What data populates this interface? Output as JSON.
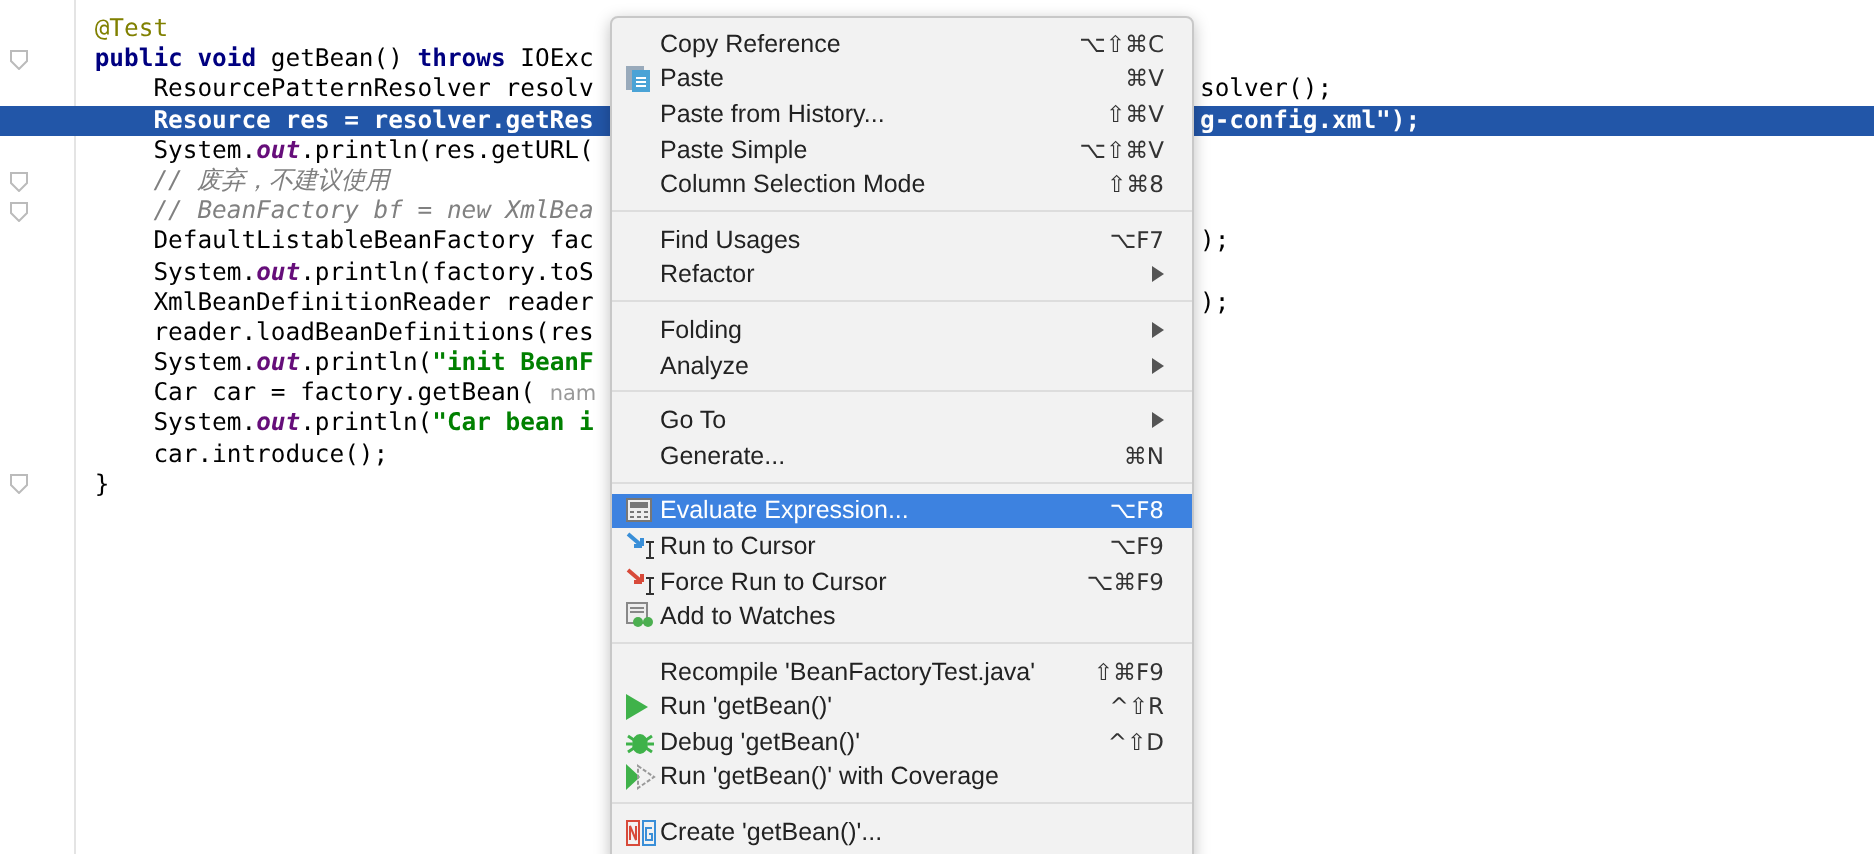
{
  "editor": {
    "lines": [
      {
        "folding": false,
        "selected": false,
        "segments": [
          {
            "kind": "annotation",
            "text": "    @Test"
          }
        ]
      },
      {
        "folding": true,
        "selected": false,
        "segments": [
          {
            "kind": "keyword",
            "text": "    public void"
          },
          {
            "kind": "plain",
            "text": " getBean() "
          },
          {
            "kind": "keyword",
            "text": "throws"
          },
          {
            "kind": "plain",
            "text": " IOExc"
          }
        ]
      },
      {
        "folding": false,
        "selected": false,
        "segments": [
          {
            "kind": "plain",
            "text": "        ResourcePatternResolver resolv"
          }
        ],
        "right": "solver();"
      },
      {
        "folding": false,
        "selected": true,
        "segments": [
          {
            "kind": "plain",
            "text": "        Resource res = resolver.getRes"
          }
        ],
        "right": "g-config.xml\");"
      },
      {
        "folding": false,
        "selected": false,
        "segments": [
          {
            "kind": "plain",
            "text": "        System."
          },
          {
            "kind": "field",
            "text": "out"
          },
          {
            "kind": "plain",
            "text": ".println(res.getURL("
          }
        ]
      },
      {
        "folding": true,
        "selected": false,
        "segments": [
          {
            "kind": "comment",
            "text": "        // 废弃，不建议使用"
          }
        ]
      },
      {
        "folding": true,
        "selected": false,
        "segments": [
          {
            "kind": "comment",
            "text": "        // BeanFactory bf = new XmlBea"
          }
        ]
      },
      {
        "folding": false,
        "selected": false,
        "segments": [
          {
            "kind": "plain",
            "text": "        DefaultListableBeanFactory fac"
          }
        ],
        "right": ");"
      },
      {
        "folding": false,
        "selected": false,
        "segments": [
          {
            "kind": "plain",
            "text": "        System."
          },
          {
            "kind": "field",
            "text": "out"
          },
          {
            "kind": "plain",
            "text": ".println(factory.toS"
          }
        ]
      },
      {
        "folding": false,
        "selected": false,
        "segments": [
          {
            "kind": "plain",
            "text": "        XmlBeanDefinitionReader reader"
          }
        ],
        "right": ");"
      },
      {
        "folding": false,
        "selected": false,
        "segments": [
          {
            "kind": "plain",
            "text": "        reader.loadBeanDefinitions(res"
          }
        ]
      },
      {
        "folding": false,
        "selected": false,
        "segments": [
          {
            "kind": "plain",
            "text": "        System."
          },
          {
            "kind": "field",
            "text": "out"
          },
          {
            "kind": "plain",
            "text": ".println("
          },
          {
            "kind": "string",
            "text": "\"init BeanF"
          }
        ]
      },
      {
        "folding": false,
        "selected": false,
        "segments": [
          {
            "kind": "plain",
            "text": "        Car car = factory.getBean( "
          },
          {
            "kind": "hint",
            "text": "nam"
          }
        ]
      },
      {
        "folding": false,
        "selected": false,
        "segments": [
          {
            "kind": "plain",
            "text": "        System."
          },
          {
            "kind": "field",
            "text": "out"
          },
          {
            "kind": "plain",
            "text": ".println("
          },
          {
            "kind": "string",
            "text": "\"Car bean i"
          }
        ]
      },
      {
        "folding": false,
        "selected": false,
        "segments": [
          {
            "kind": "plain",
            "text": "        car.introduce();"
          }
        ]
      },
      {
        "folding": true,
        "selected": false,
        "segments": [
          {
            "kind": "plain",
            "text": "    }"
          }
        ]
      }
    ]
  },
  "context_menu": {
    "groups": [
      [
        {
          "label": "Copy Reference",
          "shortcut": "⌥⇧⌘C",
          "submenu": false,
          "selected": false
        },
        {
          "label": "Paste",
          "shortcut": "⌘V",
          "kind": "paste",
          "submenu": false,
          "selected": false
        },
        {
          "label": "Paste from History...",
          "shortcut": "⇧⌘V",
          "submenu": false,
          "selected": false
        },
        {
          "label": "Paste Simple",
          "shortcut": "⌥⇧⌘V",
          "submenu": false,
          "selected": false
        },
        {
          "label": "Column Selection Mode",
          "shortcut": "⇧⌘8",
          "submenu": false,
          "selected": false
        }
      ],
      [
        {
          "label": "Find Usages",
          "shortcut": "⌥F7",
          "submenu": false,
          "selected": false
        },
        {
          "label": "Refactor",
          "submenu": true,
          "selected": false
        }
      ],
      [
        {
          "label": "Folding",
          "submenu": true,
          "selected": false
        },
        {
          "label": "Analyze",
          "submenu": true,
          "selected": false
        }
      ],
      [
        {
          "label": "Go To",
          "submenu": true,
          "selected": false
        },
        {
          "label": "Generate...",
          "shortcut": "⌘N",
          "submenu": false,
          "selected": false
        }
      ],
      [
        {
          "label": "Evaluate Expression...",
          "shortcut": "⌥F8",
          "kind": "evaluate",
          "submenu": false,
          "selected": true
        },
        {
          "label": "Run to Cursor",
          "shortcut": "⌥F9",
          "kind": "run-to-cursor",
          "submenu": false,
          "selected": false
        },
        {
          "label": "Force Run to Cursor",
          "shortcut": "⌥⌘F9",
          "kind": "force-run",
          "submenu": false,
          "selected": false
        },
        {
          "label": "Add to Watches",
          "kind": "watches",
          "submenu": false,
          "selected": false
        }
      ],
      [
        {
          "label": "Recompile 'BeanFactoryTest.java'",
          "shortcut": "⇧⌘F9",
          "submenu": false,
          "selected": false
        },
        {
          "label": "Run 'getBean()'",
          "shortcut": "^⇧R",
          "kind": "run",
          "submenu": false,
          "selected": false
        },
        {
          "label": "Debug 'getBean()'",
          "shortcut": "^⇧D",
          "kind": "debug",
          "submenu": false,
          "selected": false
        },
        {
          "label": "Run 'getBean()' with Coverage",
          "kind": "coverage",
          "submenu": false,
          "selected": false
        }
      ],
      [
        {
          "label": "Create 'getBean()'...",
          "kind": "create",
          "submenu": false,
          "selected": false
        }
      ]
    ]
  }
}
